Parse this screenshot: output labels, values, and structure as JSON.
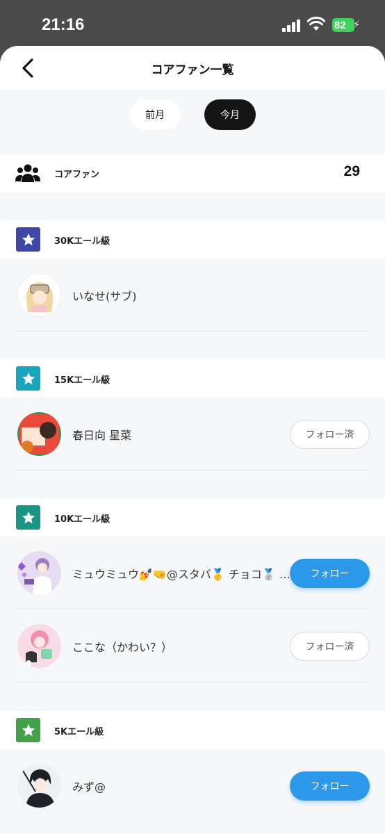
{
  "status_bar": {
    "time": "21:16",
    "battery": "82"
  },
  "header": {
    "title": "コアファン一覧"
  },
  "period_tabs": {
    "previous": "前月",
    "current": "今月"
  },
  "summary": {
    "label": "コアファン",
    "count": "29"
  },
  "tiers": [
    {
      "label": "30Kエール級",
      "color": "#3f47a8",
      "fans": [
        {
          "name": "いなせ(サブ)",
          "button": ""
        }
      ]
    },
    {
      "label": "15Kエール級",
      "color": "#17a6bf",
      "fans": [
        {
          "name": "春日向 星菜",
          "button": "フォロー済"
        }
      ]
    },
    {
      "label": "10Kエール級",
      "color": "#199683",
      "fans": [
        {
          "name": "ミュウミュウ💅🤜@スタバ🥇 チョコ🥈 ポテト🥉",
          "button": "フォロー"
        },
        {
          "name": "ここな（かわい？）",
          "button": "フォロー済"
        }
      ]
    },
    {
      "label": "5Kエール級",
      "color": "#43a148",
      "fans": [
        {
          "name": "みず@",
          "button": "フォロー"
        }
      ]
    }
  ]
}
